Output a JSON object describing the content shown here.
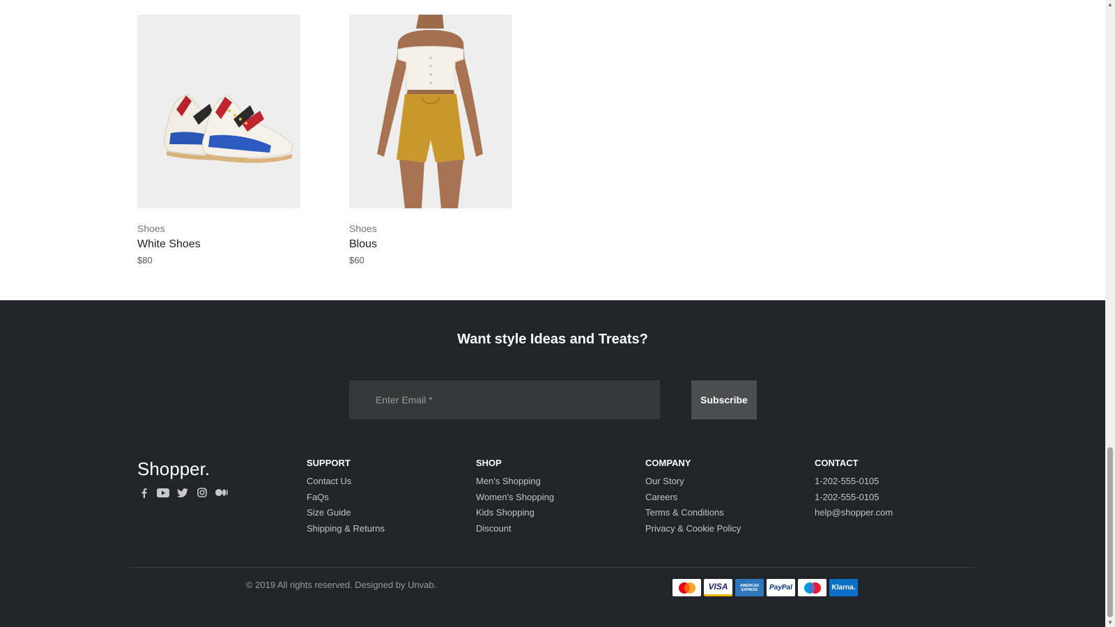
{
  "products": [
    {
      "category": "Shoes",
      "name": "White Shoes",
      "price": "$80"
    },
    {
      "category": "Shoes",
      "name": "Blous",
      "price": "$60"
    }
  ],
  "newsletter": {
    "title": "Want style Ideas and Treats?",
    "email_placeholder": "Enter Email *",
    "subscribe_label": "Subscribe"
  },
  "footer": {
    "brand": "Shopper.",
    "social_icons": [
      "facebook-icon",
      "youtube-icon",
      "twitter-icon",
      "instagram-icon",
      "medium-icon"
    ],
    "support": {
      "heading": "SUPPORT",
      "links": [
        "Contact Us",
        "FaQs",
        "Size Guide",
        "Shipping & Returns"
      ]
    },
    "shop": {
      "heading": "SHOP",
      "links": [
        "Men's Shopping",
        "Women's Shopping",
        "Kids Shopping",
        "Discount"
      ]
    },
    "company": {
      "heading": "COMPANY",
      "links": [
        "Our Story",
        "Careers",
        "Terms & Conditions",
        "Privacy & Cookie Policy"
      ]
    },
    "contact": {
      "heading": "CONTACT",
      "links": [
        "1-202-555-0105",
        "1-202-555-0105",
        "help@shopper.com"
      ]
    },
    "copyright": "© 2019 All rights reserved. Designed by Unvab.",
    "payments": [
      {
        "name": "mastercard-icon",
        "label": "",
        "bg": "#ffffff",
        "color": "#000000"
      },
      {
        "name": "visa-icon",
        "label": "VISA",
        "bg": "#ffffff",
        "color": "#1a1f71"
      },
      {
        "name": "amex-icon",
        "label": "AMERICAN EXPRESS",
        "bg": "#2e77bc",
        "color": "#ffffff"
      },
      {
        "name": "paypal-icon",
        "label": "PayPal",
        "bg": "#ffffff",
        "color": "#003087"
      },
      {
        "name": "maestro-icon",
        "label": "",
        "bg": "#ffffff",
        "color": "#000000"
      },
      {
        "name": "klarna-icon",
        "label": "Klarna.",
        "bg": "#0b70c9",
        "color": "#ffffff"
      }
    ]
  },
  "colors": {
    "footer_bg": "#212428",
    "input_bg": "#363839",
    "button_bg": "#4b4d4f",
    "product_bg": "#eeeeee"
  }
}
